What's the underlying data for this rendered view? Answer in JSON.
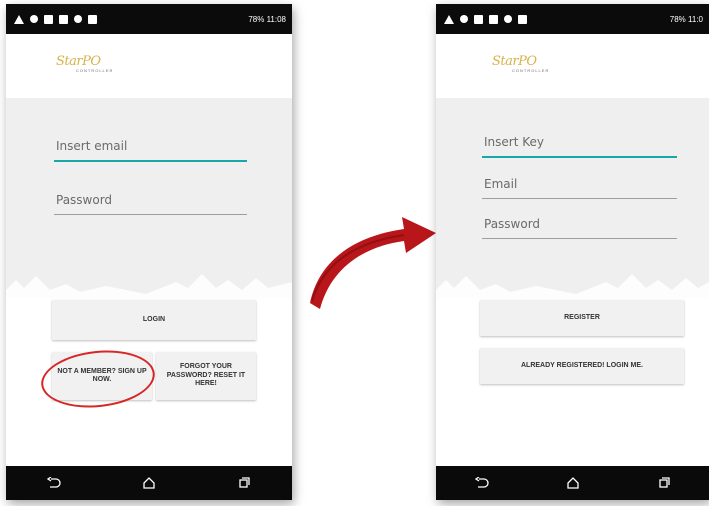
{
  "status_bar": {
    "left_text": "78%",
    "right_text": "11:08",
    "right_text_truncated": "11:0"
  },
  "login_screen": {
    "logo_text": "StarPO",
    "logo_subtext": "CONTROLLER",
    "email_placeholder": "Insert email",
    "password_placeholder": "Password",
    "login_label": "LOGIN",
    "signup_label": "NOT A MEMBER? SIGN UP NOW.",
    "forgot_label": "FORGOT YOUR PASSWORD? RESET IT HERE!"
  },
  "register_screen": {
    "logo_text": "StarPO",
    "logo_subtext": "CONTROLLER",
    "key_placeholder": "Insert Key",
    "email_placeholder": "Email",
    "password_placeholder": "Password",
    "register_label": "REGISTER",
    "already_registered_label": "ALREADY REGISTERED! LOGIN ME."
  },
  "nav_bar": {
    "icons": [
      "back-icon",
      "home-icon",
      "recents-icon"
    ]
  },
  "colors": {
    "accent": "#19a8a8",
    "highlight": "#d72626",
    "arrow": "#b8161a",
    "panel": "#efefef"
  }
}
